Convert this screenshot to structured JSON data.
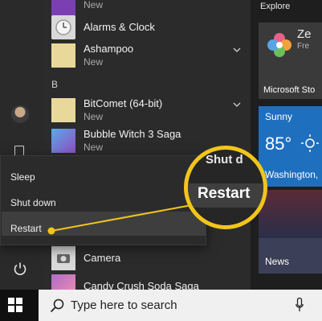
{
  "apps": [
    {
      "name": "",
      "sub": "New",
      "tile_color": "#7b3fb1"
    },
    {
      "name": "Alarms & Clock",
      "sub": "",
      "tile_color": "#dcdcdc"
    },
    {
      "name": "Ashampoo",
      "sub": "New",
      "tile_color": "#e8d99a"
    },
    {
      "name": "BitComet (64-bit)",
      "sub": "New",
      "tile_color": "#e8d99a"
    },
    {
      "name": "Bubble Witch 3 Saga",
      "sub": "New",
      "tile_color": "#5aa9e6"
    },
    {
      "name": "Camera",
      "sub": "",
      "tile_color": "#dcdcdc"
    },
    {
      "name": "Candy Crush Soda Saga",
      "sub": "",
      "tile_color": "#b06cc6"
    }
  ],
  "letter_b": "B",
  "power_menu": {
    "sleep": "Sleep",
    "shutdown": "Shut down",
    "restart": "Restart"
  },
  "callout": {
    "label": "Restart",
    "ghost": "Shut d",
    "color": "#f2c51b"
  },
  "tiles": {
    "explore": "Explore",
    "store_title": "Microsoft Sto",
    "store_badge": "Ze",
    "store_badge_sub": "Fre",
    "weather_cond": "Sunny",
    "weather_temp": "85°",
    "weather_city": "Washington,",
    "news": "News"
  },
  "taskbar": {
    "search_placeholder": "Type here to search"
  }
}
